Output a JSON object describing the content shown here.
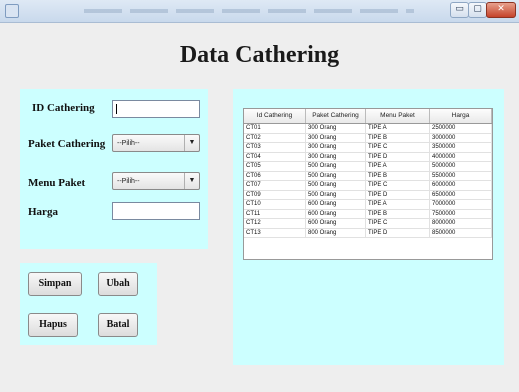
{
  "window": {
    "min_icon": "▭",
    "max_icon": "▢",
    "close_icon": "✕"
  },
  "page_title": "Data Cathering",
  "form": {
    "id_label": "ID Cathering",
    "id_value": "",
    "paket_label": "Paket Cathering",
    "paket_selected": "--Pilih--",
    "menu_label": "Menu Paket",
    "menu_selected": "--Pilih--",
    "harga_label": "Harga",
    "harga_value": ""
  },
  "buttons": {
    "simpan": "Simpan",
    "ubah": "Ubah",
    "hapus": "Hapus",
    "batal": "Batal"
  },
  "table": {
    "columns": [
      "Id Cathering",
      "Paket Cathering",
      "Menu Paket",
      "Harga"
    ],
    "rows": [
      [
        "CT01",
        "300 Orang",
        "TIPE A",
        "2500000"
      ],
      [
        "CT02",
        "300 Orang",
        "TIPE B",
        "3000000"
      ],
      [
        "CT03",
        "300 Orang",
        "TIPE C",
        "3500000"
      ],
      [
        "CT04",
        "300 Orang",
        "TIPE D",
        "4000000"
      ],
      [
        "CT05",
        "500 Orang",
        "TIPE A",
        "5000000"
      ],
      [
        "CT06",
        "500 Orang",
        "TIPE B",
        "5500000"
      ],
      [
        "CT07",
        "500 Orang",
        "TIPE C",
        "6000000"
      ],
      [
        "CT09",
        "500 Orang",
        "TIPE D",
        "6500000"
      ],
      [
        "CT10",
        "600 Orang",
        "TIPE A",
        "7000000"
      ],
      [
        "CT11",
        "600 Orang",
        "TIPE B",
        "7500000"
      ],
      [
        "CT12",
        "600 Orang",
        "TIPE C",
        "8000000"
      ],
      [
        "CT13",
        "800 Orang",
        "TIPE D",
        "8500000"
      ]
    ]
  }
}
